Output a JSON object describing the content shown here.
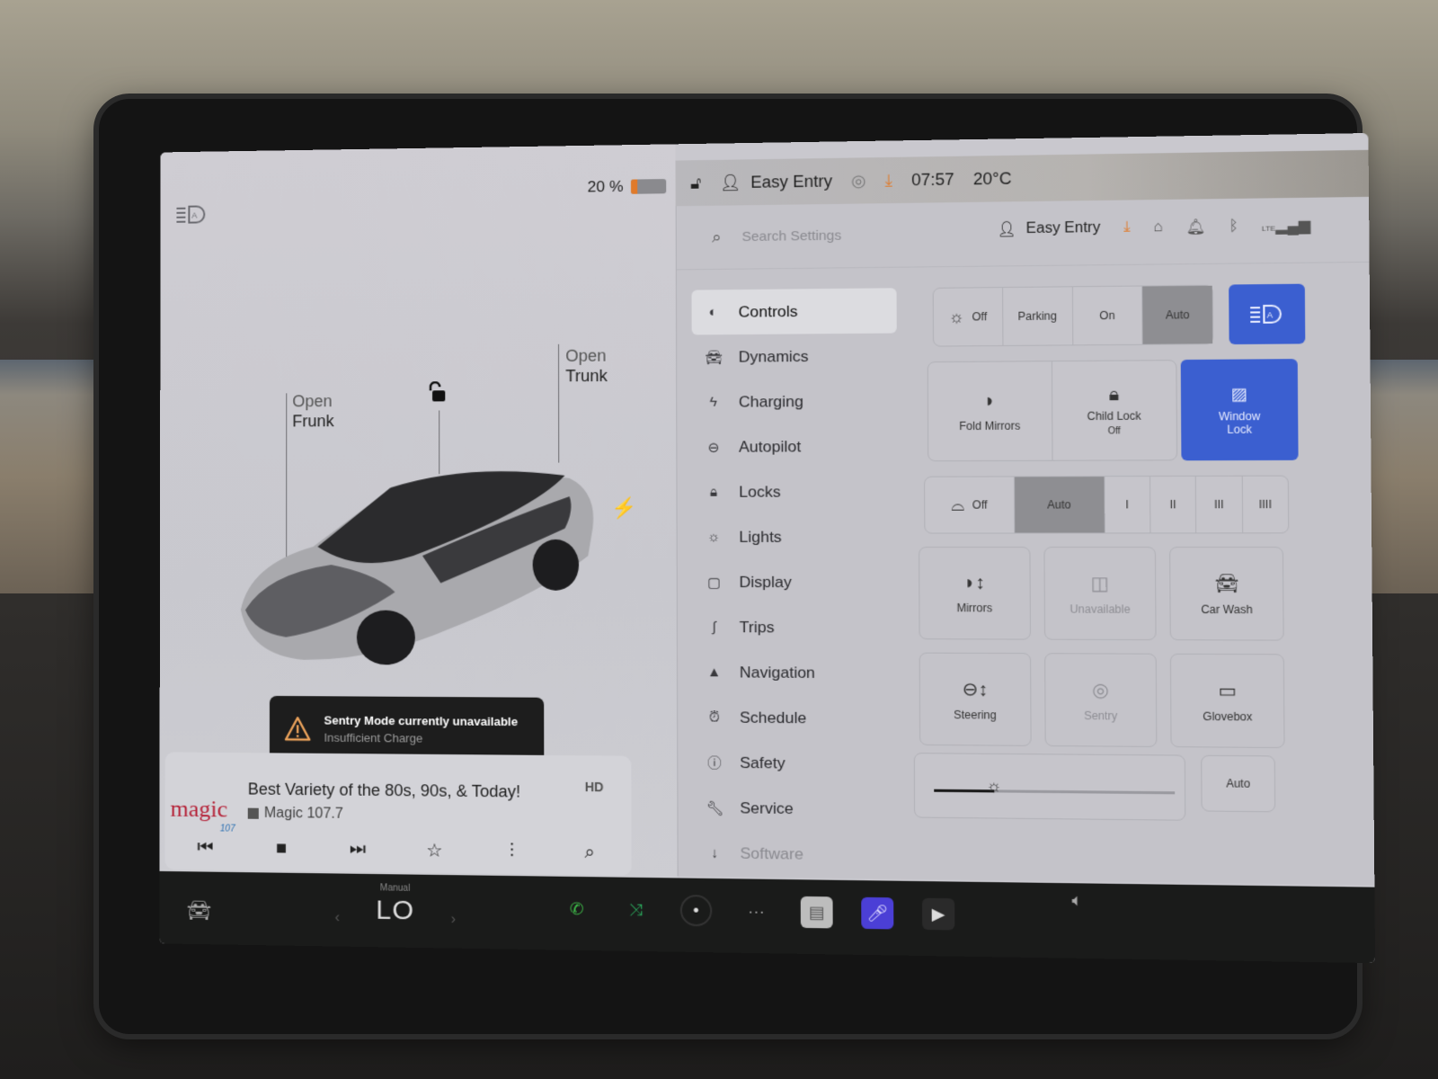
{
  "status_bar": {
    "battery_percent_label": "20 %",
    "battery_level": 0.2,
    "lock_state": "unlocked",
    "profile_name": "Easy Entry",
    "time": "07:57",
    "temperature": "20°C",
    "icons": [
      "headlight-auto-icon",
      "battery-icon",
      "unlock-icon",
      "person-icon",
      "sentry-icon",
      "download-icon"
    ]
  },
  "vehicle_view": {
    "frunk_label_top": "Open",
    "frunk_label_bottom": "Frunk",
    "trunk_label_top": "Open",
    "trunk_label_bottom": "Trunk",
    "lock_icon": "unlock-icon",
    "charge_port_icon": "lightning-icon"
  },
  "toast": {
    "title": "Sentry Mode currently unavailable",
    "subtitle": "Insufficient Charge",
    "icon": "warning-icon",
    "accent": "#e8a05a"
  },
  "media": {
    "station_logo": "magic",
    "station_logo_sub": "107",
    "song_title": "Best Variety of the 80s, 90s, & Today!",
    "station_name": "Magic 107.7",
    "hd_label": "HD",
    "controls": [
      "previous-icon",
      "stop-icon",
      "next-icon",
      "favorite-star-icon",
      "equalizer-icon",
      "search-icon"
    ]
  },
  "settings_header": {
    "search_placeholder": "Search Settings",
    "search_value": "",
    "profile_name": "Easy Entry",
    "icons": [
      "download-icon",
      "homelink-icon",
      "alarm-bell-icon",
      "bluetooth-icon",
      "lte-signal-icon"
    ],
    "lte_label": "LTE"
  },
  "nav": {
    "items": [
      {
        "label": "Controls",
        "icon": "toggle-icon",
        "active": true
      },
      {
        "label": "Dynamics",
        "icon": "car-icon",
        "active": false
      },
      {
        "label": "Charging",
        "icon": "lightning-icon",
        "active": false
      },
      {
        "label": "Autopilot",
        "icon": "steering-wheel-icon",
        "active": false
      },
      {
        "label": "Locks",
        "icon": "lock-icon",
        "active": false
      },
      {
        "label": "Lights",
        "icon": "sun-icon",
        "active": false
      },
      {
        "label": "Display",
        "icon": "display-icon",
        "active": false
      },
      {
        "label": "Trips",
        "icon": "trips-icon",
        "active": false
      },
      {
        "label": "Navigation",
        "icon": "navigation-arrow-icon",
        "active": false
      },
      {
        "label": "Schedule",
        "icon": "alarm-clock-icon",
        "active": false
      },
      {
        "label": "Safety",
        "icon": "exclamation-circle-icon",
        "active": false
      },
      {
        "label": "Service",
        "icon": "wrench-icon",
        "active": false
      },
      {
        "label": "Software",
        "icon": "download-arrow-icon",
        "active": false
      }
    ]
  },
  "controls": {
    "headlights": {
      "options": [
        "Off",
        "Parking",
        "On",
        "Auto"
      ],
      "selected": "Auto",
      "auto_high_beam_active": true
    },
    "row2": {
      "fold_mirrors": "Fold Mirrors",
      "child_lock": "Child Lock",
      "child_lock_state": "Off",
      "window_lock_line1": "Window",
      "window_lock_line2": "Lock",
      "window_lock_active": true
    },
    "wipers": {
      "options": [
        "Off",
        "Auto",
        "I",
        "II",
        "III",
        "IIII"
      ],
      "selected": "Auto"
    },
    "tiles": [
      {
        "label": "Mirrors",
        "icon": "mirror-adjust-icon",
        "disabled": false
      },
      {
        "label": "Unavailable",
        "icon": "camera-icon",
        "disabled": true
      },
      {
        "label": "Car Wash",
        "icon": "car-wash-icon",
        "disabled": false
      },
      {
        "label": "Steering",
        "icon": "steering-adjust-icon",
        "disabled": false
      },
      {
        "label": "Sentry",
        "icon": "sentry-icon",
        "disabled": true
      },
      {
        "label": "Glovebox",
        "icon": "glovebox-icon",
        "disabled": false
      }
    ],
    "brightness": {
      "level": 0.25,
      "auto_label": "Auto"
    }
  },
  "bottom_bar": {
    "climate_mode": "Manual",
    "climate_temp": "LO",
    "dock_icons": [
      "phone-icon",
      "shuffle-icon",
      "camera-icon",
      "more-icon",
      "radio-icon",
      "karaoke-icon",
      "theater-icon"
    ],
    "volume_icon": "volume-icon",
    "colors": {
      "phone": "#3fbf4a",
      "karaoke": "#4b3fd6"
    }
  }
}
